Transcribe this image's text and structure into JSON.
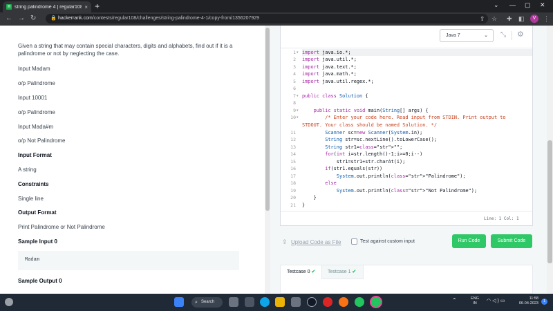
{
  "browser": {
    "tab_title": "string palindrome 4 | regular108",
    "tab_close": "×",
    "new_tab": "+",
    "url_host": "hackerrank.com",
    "url_path": "/contests/regular108/challenges/string-palindrome-4-1/copy-from/1356207929",
    "profile_initial": "V"
  },
  "problem": {
    "description": "Given a string that may contain special characters, digits and alphabets, find out if it is a palindrome or not by neglecting the case.",
    "lines": [
      "Input Madam",
      "o/p Palindrome",
      "Input 10001",
      "o/p Palindrome",
      "Input Mada#m",
      "o/p Not Palindrome"
    ],
    "input_format_heading": "Input Format",
    "input_format": "A string",
    "constraints_heading": "Constraints",
    "constraints": "Single line",
    "output_format_heading": "Output Format",
    "output_format": "Print Palindrome or Not Palindrome",
    "sample_input_heading": "Sample Input 0",
    "sample_input": "Madam",
    "sample_output_heading": "Sample Output 0"
  },
  "editor": {
    "language": "Java 7",
    "line_numbers": [
      "1",
      "2",
      "3",
      "4",
      "5",
      "6",
      "7",
      "8",
      "9",
      "10",
      "11",
      "12",
      "13",
      "14",
      "15",
      "16",
      "17",
      "18",
      "19",
      "20",
      "21"
    ],
    "cursor_position": "Line: 1 Col: 1"
  },
  "actions": {
    "upload_label": "Upload Code as File",
    "custom_input_label": "Test against custom input",
    "run_label": "Run Code",
    "submit_label": "Submit Code"
  },
  "testcases": {
    "tab0": "Testcase 0",
    "tab1": "Testcase 1"
  },
  "taskbar": {
    "search_label": "Search",
    "lang_line1": "ENG",
    "lang_line2": "IN",
    "time": "11:58",
    "date": "06-04-2023",
    "notification_count": "1"
  }
}
